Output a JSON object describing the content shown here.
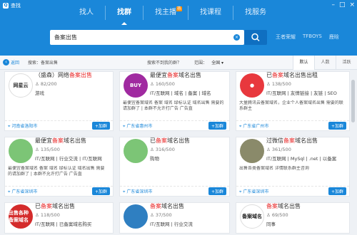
{
  "window": {
    "title": "查找",
    "logo_text": "Q"
  },
  "nav": {
    "tabs": [
      "找人",
      "找群",
      "找主播",
      "找课程",
      "找服务"
    ],
    "hot_badge": "热"
  },
  "search": {
    "value": "备案出售",
    "clear_glyph": "×"
  },
  "trending": [
    "王者荣耀",
    "TFBOYS",
    "鹿晗"
  ],
  "filter": {
    "back_label": "返回",
    "search_text": "搜索：备案出售",
    "not_found": "搜索不到我的群？",
    "scope_label": "范围：",
    "scope_value": "全国",
    "sort_tabs": [
      "默认",
      "人数",
      "活跃"
    ]
  },
  "cards": [
    {
      "pre": "（盛森）网络",
      "hl": "备案出售",
      "post": "",
      "members": "82/200",
      "tags": "游戏",
      "desc": "",
      "location": "河南省洛阳市",
      "add": "+加群",
      "avatar_text": "网星云",
      "avatar_bg": "#ffffff",
      "avatar_fg": "#333333"
    },
    {
      "pre": "最便宜",
      "hl": "备案",
      "post": "域名出售",
      "members": "160/500",
      "tags": "IT/互联网 | 域名 | 备案 | 域名",
      "desc": "最便宜备案域名 备案 域名 绿标认证 域名出售 需要的请加群了 | 本群不允许打广告 广告直",
      "location": "广东省惠州市",
      "add": "+加群",
      "avatar_text": "BUY",
      "avatar_bg": "#a02aa0",
      "avatar_fg": "#ffffff"
    },
    {
      "pre": "已",
      "hl": "备案",
      "post": "域名出售出租",
      "members": "138/500",
      "tags": "IT/互联网 | 友情链接 | 友链 | SEO",
      "desc": "大量腾讯云备案域名，企业个人备案域名出售 需要的联系群主",
      "location": "广东省广州市",
      "add": "+加群",
      "avatar_text": "●",
      "avatar_bg": "#e8383d",
      "avatar_fg": "#ffffff"
    },
    {
      "pre": "最便宜",
      "hl": "备案",
      "post": "域名出售",
      "members": "135/500",
      "tags": "IT/互联网 | 行业交流 | IT/互联网",
      "desc": "最便宜备案域名 备案 域名 绿标认证 域名出售 需要的请加群了 | 本群不允许打广告 广告直",
      "location": "广东省深圳市",
      "add": "+加群",
      "avatar_text": "",
      "avatar_bg": "#7cc576",
      "avatar_fg": "#ffffff"
    },
    {
      "pre": "已",
      "hl": "备案",
      "post": "域名出售",
      "members": "316/500",
      "tags": "购物",
      "desc": "",
      "location": "广东省深圳市",
      "add": "+加群",
      "avatar_text": "",
      "avatar_bg": "#7cc576",
      "avatar_fg": "#ffffff"
    },
    {
      "pre": "过微信",
      "hl": "备案",
      "post": "域名出售",
      "members": "361/500",
      "tags": "IT/互联网 | MySql | .net | 以备案",
      "desc": "出售各类备案域名 详情联系群主咨询",
      "location": "广东省深圳市",
      "add": "+加群",
      "avatar_text": "",
      "avatar_bg": "#8a8a6a",
      "avatar_fg": "#ffffff"
    },
    {
      "pre": "已",
      "hl": "备案",
      "post": "域名出售",
      "members": "118/500",
      "tags": "IT/互联网 | 已备案域名购买",
      "desc": "",
      "location": "",
      "add": "",
      "avatar_text": "出售各种备案域名",
      "avatar_bg": "#d42b2b",
      "avatar_fg": "#ffffff",
      "last": true
    },
    {
      "pre": "",
      "hl": "备案",
      "post": "域名出售",
      "members": "37/500",
      "tags": "IT/互联网 | 行业交流",
      "desc": "",
      "location": "",
      "add": "",
      "avatar_text": "",
      "avatar_bg": "#2f7fc1",
      "avatar_fg": "#ffffff",
      "last": true
    },
    {
      "pre": "",
      "hl": "备案",
      "post": "域名出售",
      "members": "69/500",
      "tags": "同事",
      "desc": "",
      "location": "",
      "add": "",
      "avatar_text": "备案域名",
      "avatar_bg": "#ffffff",
      "avatar_fg": "#222222",
      "last": true
    }
  ]
}
